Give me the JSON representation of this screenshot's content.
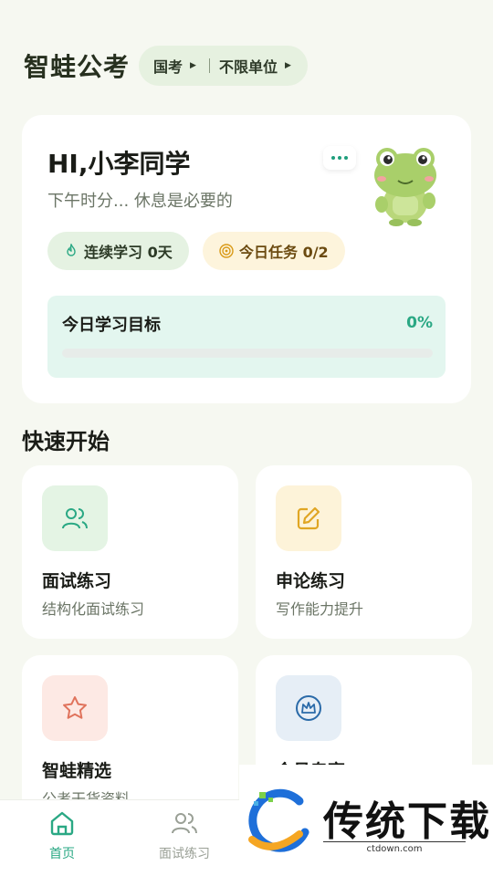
{
  "header": {
    "app_title": "智蛙公考",
    "exam_type": "国考",
    "unit_filter": "不限单位"
  },
  "greeting": {
    "name": "HI,小李同学",
    "subtitle": "下午时分... 休息是必要的",
    "streak_label": "连续学习 0天",
    "task_label": "今日任务 0/2",
    "goal_title": "今日学习目标",
    "goal_percent_text": "0%",
    "goal_progress": 0
  },
  "quick_start": {
    "title": "快速开始",
    "items": [
      {
        "name": "面试练习",
        "desc": "结构化面试练习",
        "icon": "users-icon"
      },
      {
        "name": "申论练习",
        "desc": "写作能力提升",
        "icon": "edit-icon"
      },
      {
        "name": "智蛙精选",
        "desc": "公考干货资料",
        "icon": "star-icon"
      },
      {
        "name": "会员专享",
        "desc": "",
        "icon": "crown-icon"
      }
    ]
  },
  "tabbar": {
    "items": [
      {
        "label": "首页",
        "icon": "home-icon",
        "active": true
      },
      {
        "label": "面试练习",
        "icon": "users-icon",
        "active": false
      }
    ]
  },
  "watermark": {
    "brand": "传统下载",
    "site": "ctdown.com"
  },
  "colors": {
    "accent": "#2aa884",
    "background": "#f6f8f1",
    "streak_pill": "#e5f2e2",
    "task_pill": "#fdf4dc"
  }
}
